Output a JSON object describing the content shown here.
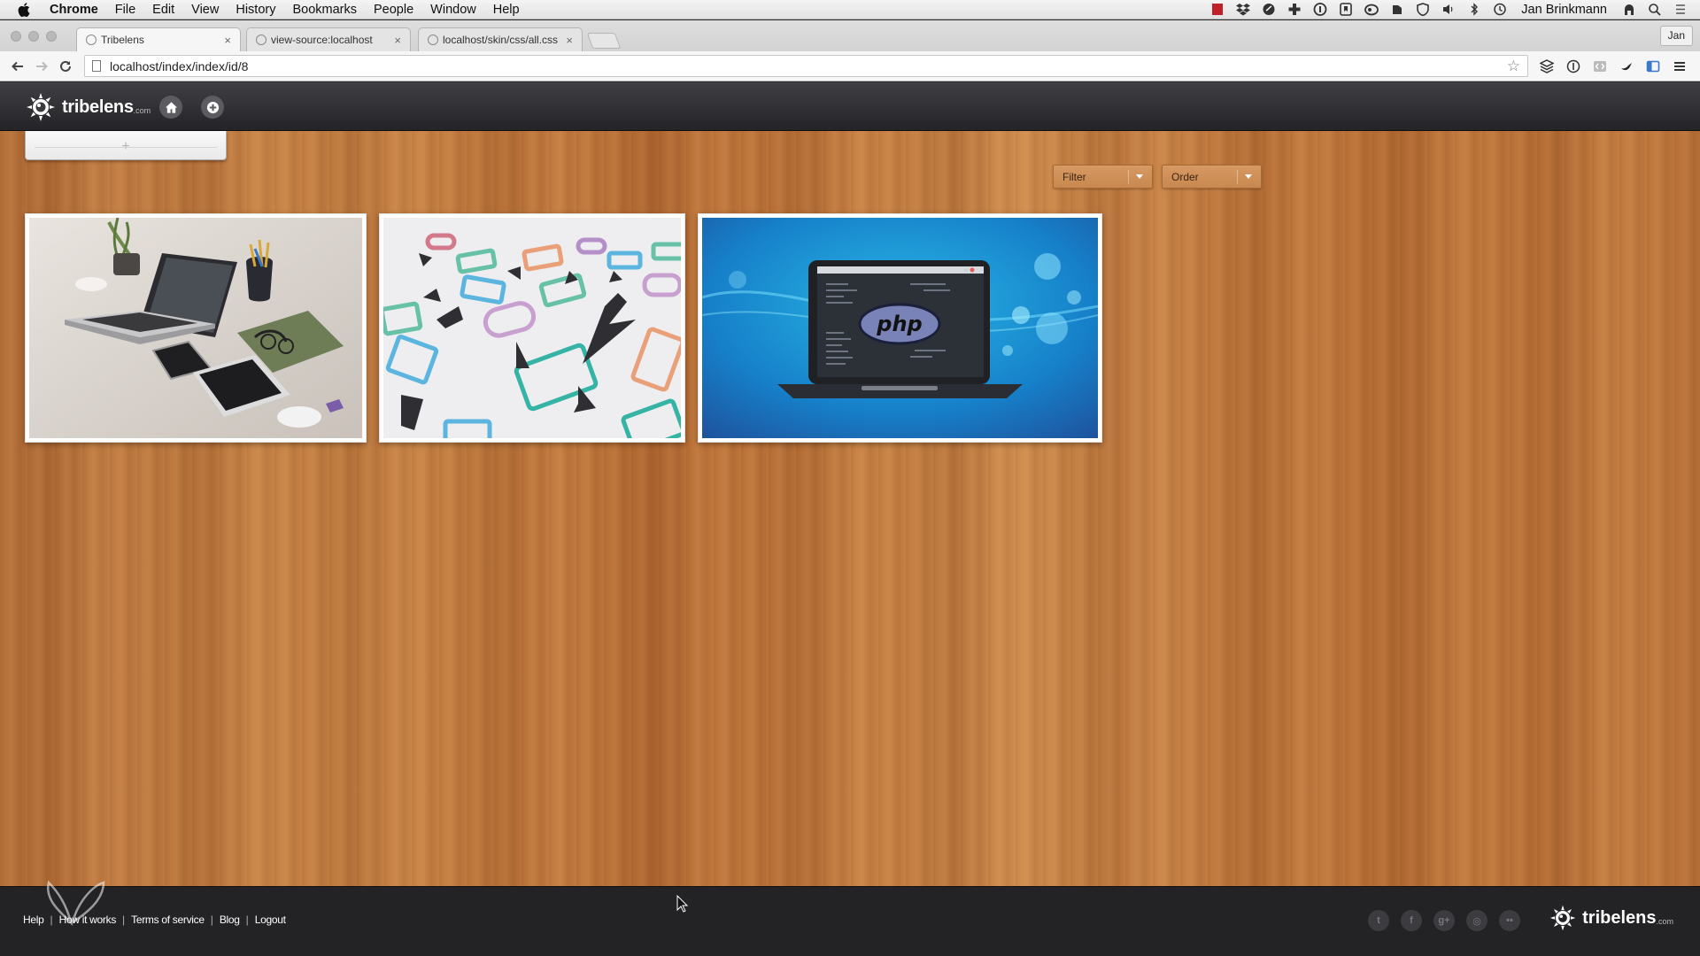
{
  "menubar": {
    "app_name": "Chrome",
    "items": [
      "File",
      "Edit",
      "View",
      "History",
      "Bookmarks",
      "People",
      "Window",
      "Help"
    ],
    "user_name": "Jan Brinkmann"
  },
  "tabs": [
    {
      "title": "Tribelens",
      "active": true
    },
    {
      "title": "view-source:localhost",
      "active": false
    },
    {
      "title": "localhost/skin/css/all.css",
      "active": false
    }
  ],
  "profile_button": "Jan",
  "address_bar": {
    "url": "localhost/index/index/id/8"
  },
  "app": {
    "logo_text": "tribelens",
    "logo_suffix": ".com"
  },
  "controls": {
    "filter_label": "Filter",
    "order_label": "Order"
  },
  "footer": {
    "links": [
      "Help",
      "How it works",
      "Terms of service",
      "Blog",
      "Logout"
    ],
    "social_icons": [
      "twitter-icon",
      "facebook-icon",
      "google-plus-icon",
      "dribbble-icon",
      "flickr-icon"
    ],
    "logo_text": "tribelens",
    "logo_suffix": ".com"
  },
  "colors": {
    "header_bg": "#2f2f33",
    "footer_bg": "#232326",
    "wood": "#c17a3f",
    "dropdown": "#cf8f57"
  }
}
